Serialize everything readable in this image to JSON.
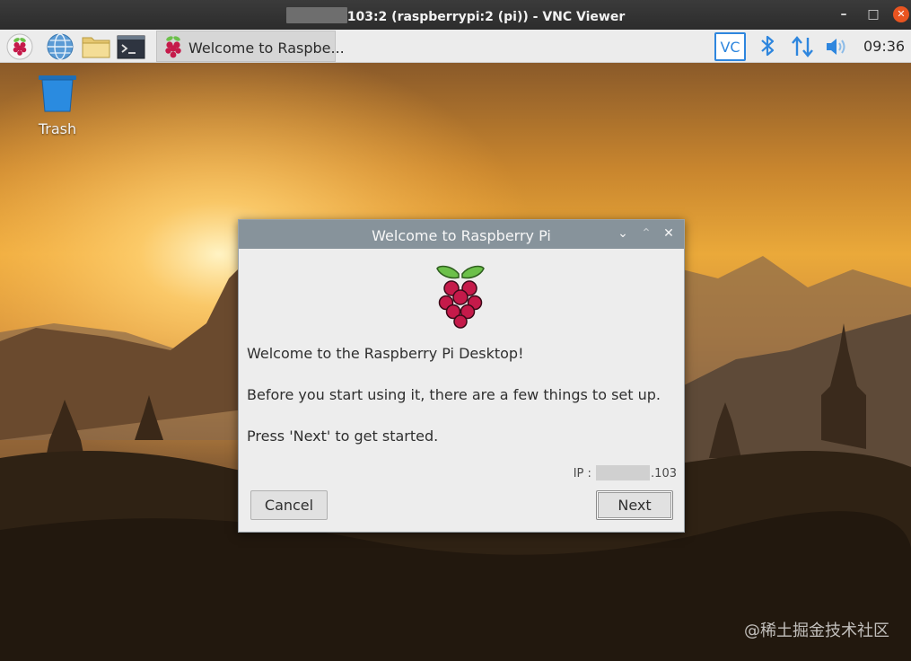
{
  "vnc_window": {
    "title": "103:2 (raspberrypi:2 (pi)) - VNC Viewer",
    "controls": {
      "minimize": "–",
      "maximize": "□",
      "close": "✕"
    }
  },
  "taskbar": {
    "launchers": [
      "raspberry-menu-icon",
      "web-browser-icon",
      "file-manager-icon",
      "terminal-icon"
    ],
    "task_label": "Welcome to Raspbe...",
    "tray": {
      "vnc_label": "VC",
      "icons": [
        "vnc-server-icon",
        "bluetooth-icon",
        "network-arrows-icon",
        "volume-icon"
      ],
      "clock": "09:36"
    }
  },
  "desktop": {
    "trash_label": "Trash",
    "watermark": "@稀土掘金技术社区"
  },
  "dialog": {
    "title": "Welcome to Raspberry Pi",
    "controls": {
      "minimize": "⌄",
      "maximize": "⌃",
      "close": "✕"
    },
    "lines": [
      "Welcome to the Raspberry Pi Desktop!",
      "Before you start using it, there are a few things to set up.",
      "Press 'Next' to get started."
    ],
    "ip_label": "IP :",
    "ip_suffix": ".103",
    "cancel_label": "Cancel",
    "next_label": "Next"
  },
  "colors": {
    "taskbar_bg": "#ececec",
    "dialog_titlebar": "#87939b",
    "dialog_bg": "#ededed",
    "raspberry_red": "#c51a4a",
    "leaf_green": "#6cc04a",
    "tray_blue": "#2e86de"
  }
}
